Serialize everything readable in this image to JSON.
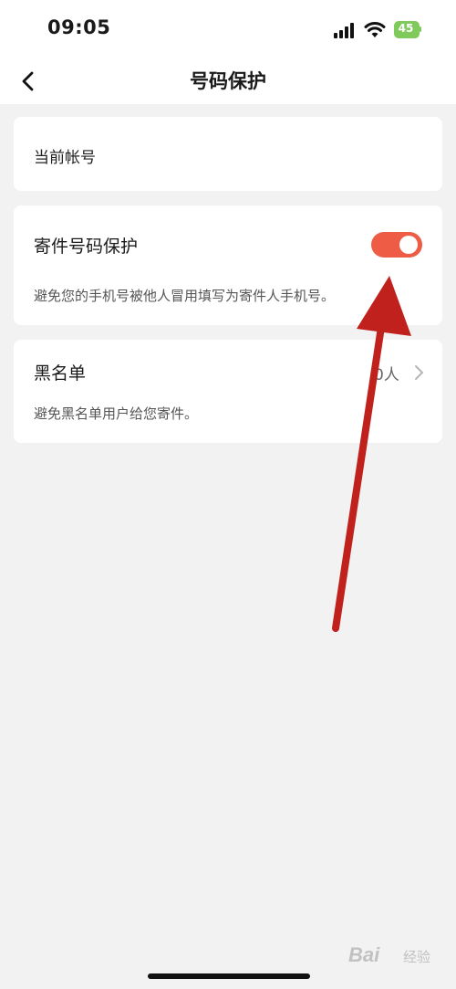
{
  "status_bar": {
    "time": "09:05",
    "battery_level": "45",
    "battery_color": "#7fca5a"
  },
  "nav": {
    "title": "号码保护",
    "back_icon": "chevron-left-icon"
  },
  "account": {
    "label": "当前帐号"
  },
  "sender_protection": {
    "title": "寄件号码保护",
    "enabled": true,
    "description": "避免您的手机号被他人冒用填写为寄件人手机号。",
    "toggle_color": "#ee5c46"
  },
  "blacklist": {
    "title": "黑名单",
    "count": "0人",
    "description": "避免黑名单用户给您寄件。"
  },
  "annotation": {
    "arrow_color": "#c0211d"
  },
  "watermark": {
    "brand": "Bai",
    "sub": "经验"
  }
}
